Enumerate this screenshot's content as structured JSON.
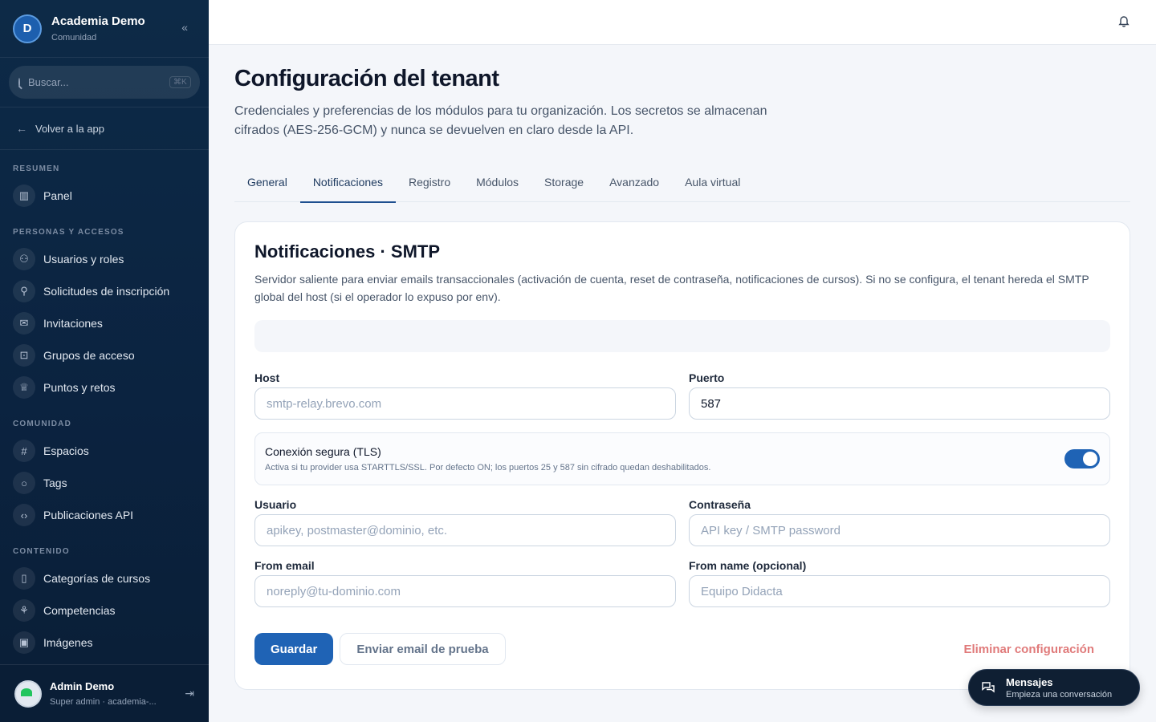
{
  "sidebar": {
    "org_name": "Academia Demo",
    "org_sub": "Comunidad",
    "logo_letter": "D",
    "collapse_glyph": "«",
    "search_placeholder": "Buscar...",
    "search_shortcut": "⌘K",
    "back_label": "Volver a la app",
    "sections": [
      {
        "title": "RESUMEN",
        "items": [
          {
            "label": "Panel",
            "icon": "chart-bars-icon",
            "glyph": "▥"
          }
        ]
      },
      {
        "title": "PERSONAS Y ACCESOS",
        "items": [
          {
            "label": "Usuarios y roles",
            "icon": "users-icon",
            "glyph": "⚇"
          },
          {
            "label": "Solicitudes de inscripción",
            "icon": "user-icon",
            "glyph": "⚲"
          },
          {
            "label": "Invitaciones",
            "icon": "mail-icon",
            "glyph": "✉"
          },
          {
            "label": "Grupos de acceso",
            "icon": "lock-icon",
            "glyph": "⊡"
          },
          {
            "label": "Puntos y retos",
            "icon": "trophy-icon",
            "glyph": "♕"
          }
        ]
      },
      {
        "title": "COMUNIDAD",
        "items": [
          {
            "label": "Espacios",
            "icon": "hash-icon",
            "glyph": "#"
          },
          {
            "label": "Tags",
            "icon": "chat-bubble-icon",
            "glyph": "○"
          },
          {
            "label": "Publicaciones API",
            "icon": "code-icon",
            "glyph": "‹›"
          }
        ]
      },
      {
        "title": "CONTENIDO",
        "items": [
          {
            "label": "Categorías de cursos",
            "icon": "book-icon",
            "glyph": "▯"
          },
          {
            "label": "Competencias",
            "icon": "award-icon",
            "glyph": "⚘"
          },
          {
            "label": "Imágenes",
            "icon": "image-icon",
            "glyph": "▣"
          }
        ]
      }
    ],
    "user": {
      "name": "Admin Demo",
      "role": "Super admin · academia-..."
    }
  },
  "page": {
    "title": "Configuración del tenant",
    "description": "Credenciales y preferencias de los módulos para tu organización. Los secretos se almacenan cifrados (AES-256-GCM) y nunca se devuelven en claro desde la API."
  },
  "tabs": [
    {
      "label": "General",
      "active": false
    },
    {
      "label": "Notificaciones",
      "active": true
    },
    {
      "label": "Registro",
      "active": false
    },
    {
      "label": "Módulos",
      "active": false
    },
    {
      "label": "Storage",
      "active": false
    },
    {
      "label": "Avanzado",
      "active": false
    },
    {
      "label": "Aula virtual",
      "active": false
    }
  ],
  "card": {
    "title": "Notificaciones · SMTP",
    "description": "Servidor saliente para enviar emails transaccionales (activación de cuenta, reset de contraseña, notificaciones de cursos). Si no se configura, el tenant hereda el SMTP global del host (si el operador lo expuso por env).",
    "fields": {
      "host": {
        "label": "Host",
        "value": "",
        "placeholder": "smtp-relay.brevo.com"
      },
      "port": {
        "label": "Puerto",
        "value": "587",
        "placeholder": ""
      },
      "user": {
        "label": "Usuario",
        "value": "",
        "placeholder": "apikey, postmaster@dominio, etc."
      },
      "password": {
        "label": "Contraseña",
        "value": "",
        "placeholder": "API key / SMTP password"
      },
      "from_email": {
        "label": "From email",
        "value": "",
        "placeholder": "noreply@tu-dominio.com"
      },
      "from_name": {
        "label": "From name (opcional)",
        "value": "",
        "placeholder": "Equipo Didacta"
      }
    },
    "tls": {
      "title": "Conexión segura (TLS)",
      "hint": "Activa si tu provider usa STARTTLS/SSL. Por defecto ON; los puertos 25 y 587 sin cifrado quedan deshabilitados.",
      "enabled": true
    },
    "buttons": {
      "save": "Guardar",
      "test": "Enviar email de prueba",
      "delete": "Eliminar configuración"
    }
  },
  "chat": {
    "title": "Mensajes",
    "subtitle": "Empieza una conversación"
  },
  "colors": {
    "primary": "#1f63b5",
    "sidebar": "#0b2340",
    "danger": "#e07a7a"
  }
}
